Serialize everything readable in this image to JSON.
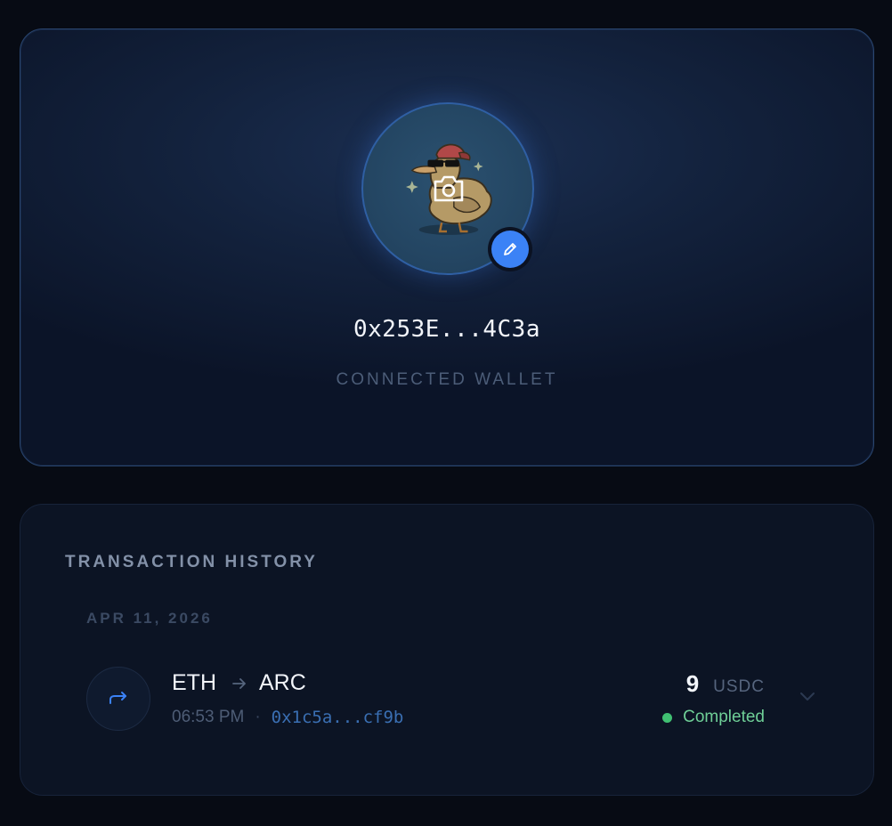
{
  "profile": {
    "wallet_address": "0x253E...4C3a",
    "wallet_label": "CONNECTED WALLET",
    "avatar_icon": "duck-avatar",
    "upload_icon": "camera-icon",
    "edit_icon": "pencil-icon",
    "accent_color": "#3b82f6"
  },
  "history": {
    "title": "TRANSACTION HISTORY",
    "groups": [
      {
        "date": "APR 11, 2026",
        "transactions": [
          {
            "icon": "forward-arrow-icon",
            "from": "ETH",
            "to": "ARC",
            "time": "06:53 PM",
            "separator": "·",
            "hash": "0x1c5a...cf9b",
            "amount": "9",
            "unit": "USDC",
            "status": "Completed",
            "status_color": "#4ade80"
          }
        ]
      }
    ]
  }
}
